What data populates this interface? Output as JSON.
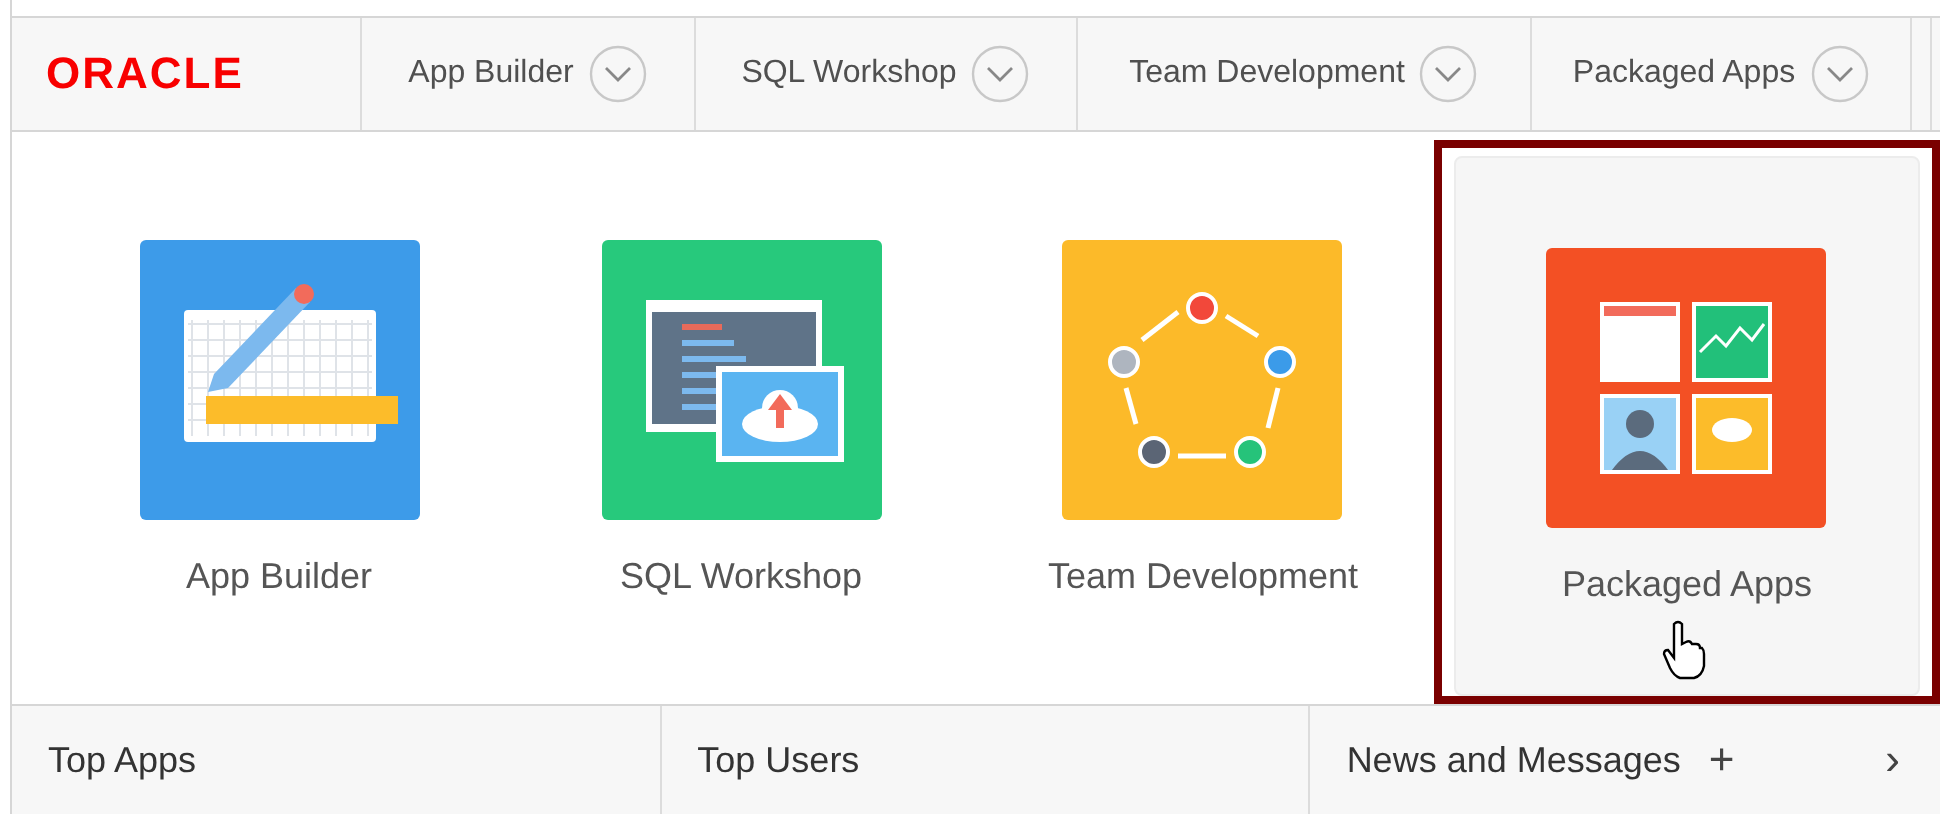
{
  "header": {
    "logo": "ORACLE",
    "menus": [
      {
        "label": "App Builder"
      },
      {
        "label": "SQL Workshop"
      },
      {
        "label": "Team Development"
      },
      {
        "label": "Packaged Apps"
      }
    ]
  },
  "tiles": [
    {
      "label": "App Builder",
      "kind": "builder",
      "color": "#3d9be9",
      "highlighted": false
    },
    {
      "label": "SQL Workshop",
      "kind": "sql",
      "color": "#27c97c",
      "highlighted": false
    },
    {
      "label": "Team Development",
      "kind": "team",
      "color": "#fcba29",
      "highlighted": false
    },
    {
      "label": "Packaged Apps",
      "kind": "packaged",
      "color": "#f35024",
      "highlighted": true
    }
  ],
  "footer": {
    "sections": [
      {
        "title": "Top Apps"
      },
      {
        "title": "Top Users"
      },
      {
        "title": "News and Messages",
        "actions": [
          "+",
          "›"
        ]
      }
    ]
  }
}
